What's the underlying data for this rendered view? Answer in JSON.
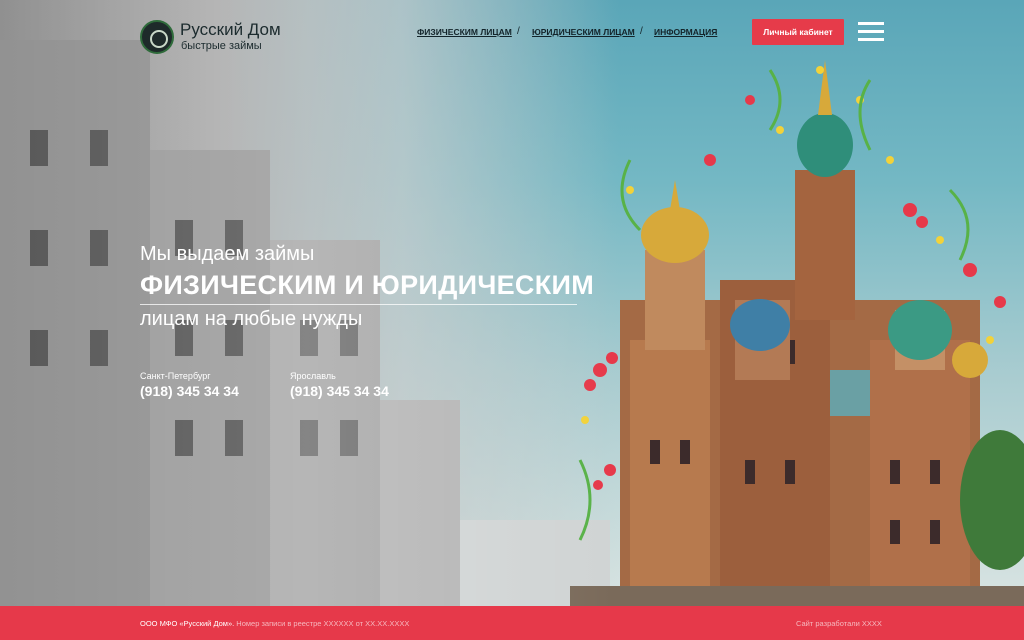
{
  "header": {
    "brand_name": "Русский Дом",
    "brand_tagline": "быстрые займы",
    "nav": [
      {
        "label": "ФИЗИЧЕСКИМ ЛИЦАМ"
      },
      {
        "label": "ЮРИДИЧЕСКИМ ЛИЦАМ"
      },
      {
        "label": "ИНФОРМАЦИЯ"
      }
    ],
    "nav_separator": "/",
    "cabinet_button": "Личный кабинет",
    "menu_icon": "hamburger-icon"
  },
  "hero": {
    "line1": "Мы выдаем займы",
    "line2": "ФИЗИЧЕСКИМ И ЮРИДИЧЕСКИМ",
    "line3": "лицам на любые нужды",
    "contacts": [
      {
        "city": "Санкт-Петербург",
        "phone": "(918) 345 34 34"
      },
      {
        "city": "Ярославль",
        "phone": "(918) 345 34 34"
      }
    ]
  },
  "footer": {
    "company": "ООО МФО «Русский Дом».",
    "registry": "Номер записи в реестре XXXXXX от XX.XX.XXXX",
    "credit": "Сайт разработали XXXX"
  },
  "colors": {
    "accent": "#e6394a",
    "sky": "#5aa6b8"
  }
}
